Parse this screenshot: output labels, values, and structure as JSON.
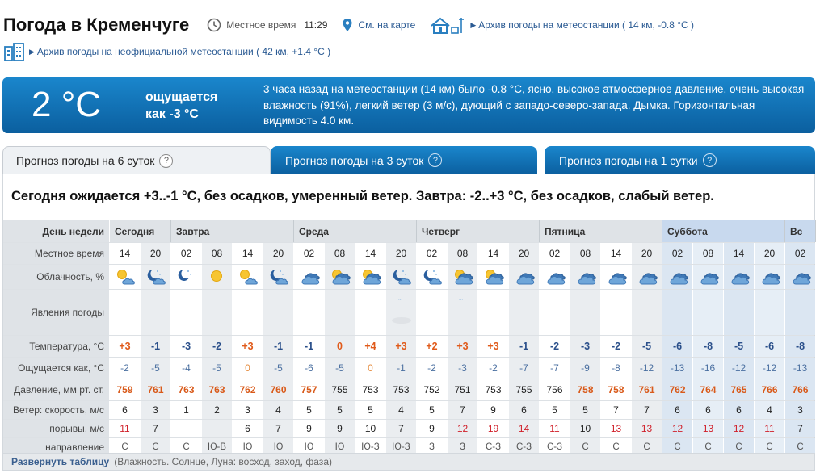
{
  "header": {
    "title": "Погода в Кременчуге",
    "local_time_label": "Местное время",
    "local_time": "11:29",
    "map_link": "См. на карте",
    "archive_station": "Архив погоды на метеостанции ( 14 км, -0.8 °C )",
    "archive_unofficial": "Архив погоды на неофициальной метеостанции ( 42 км, +1.4 °C )"
  },
  "current": {
    "temp": "2 °C",
    "feels_line1": "ощущается",
    "feels_line2": "как -3 °C",
    "description": "3 часа назад на метеостанции (14 км) было -0.8 °C, ясно, высокое атмосферное давление, очень высокая влажность (91%), легкий ветер (3 м/с), дующий с западо-северо-запада. Дымка. Горизонтальная видимость 4.0 км."
  },
  "tabs": [
    {
      "label": "Прогноз погоды на 6 суток"
    },
    {
      "label": "Прогноз погоды на 3 суток"
    },
    {
      "label": "Прогноз погоды на 1 сутки"
    }
  ],
  "summary": "Сегодня ожидается +3..-1 °C, без осадков, умеренный ветер. Завтра: -2..+3 °C, без осадков, слабый ветер.",
  "labels": {
    "day": "День недели",
    "time": "Местное время",
    "clouds": "Облачность, %",
    "phenomena": "Явления погоды",
    "temp": "Температура, °C",
    "feels": "Ощущается как, °C",
    "pressure": "Давление, мм рт. ст.",
    "wind_speed": "Ветер: скорость, м/с",
    "gusts": "порывы, м/с",
    "direction": "направление"
  },
  "days": [
    {
      "name": "Сегодня",
      "span": 2,
      "weekend": false
    },
    {
      "name": "Завтра",
      "span": 4,
      "weekend": false
    },
    {
      "name": "Среда",
      "span": 4,
      "weekend": false
    },
    {
      "name": "Четверг",
      "span": 4,
      "weekend": false
    },
    {
      "name": "Пятница",
      "span": 4,
      "weekend": false
    },
    {
      "name": "Суббота",
      "span": 4,
      "weekend": true
    },
    {
      "name": "Вс",
      "span": 1,
      "weekend": true
    }
  ],
  "times": [
    "14",
    "20",
    "02",
    "08",
    "14",
    "20",
    "02",
    "08",
    "14",
    "20",
    "02",
    "08",
    "14",
    "20",
    "02",
    "08",
    "14",
    "20",
    "02",
    "08",
    "14",
    "20",
    "02"
  ],
  "clouds": [
    "sun-cloud",
    "night-cloud",
    "night",
    "sun",
    "sun-cloud",
    "night-cloud",
    "clouds",
    "sun-clouds",
    "sun-clouds",
    "night-cloud",
    "night-cloud",
    "sun-clouds",
    "sun-clouds",
    "clouds",
    "clouds",
    "clouds",
    "clouds",
    "clouds",
    "clouds",
    "clouds",
    "clouds",
    "clouds",
    "clouds"
  ],
  "phenomena": [
    "",
    "",
    "",
    "",
    "",
    "",
    "",
    "",
    "",
    "fog",
    "",
    "snow",
    "",
    "",
    "",
    "",
    "",
    "",
    "",
    "",
    "",
    "",
    ""
  ],
  "temps": [
    "+3",
    "-1",
    "-3",
    "-2",
    "+3",
    "-1",
    "-1",
    "0",
    "+4",
    "+3",
    "+2",
    "+3",
    "+3",
    "-1",
    "-2",
    "-3",
    "-2",
    "-5",
    "-6",
    "-8",
    "-5",
    "-6",
    "-8"
  ],
  "feels": [
    "-2",
    "-5",
    "-4",
    "-5",
    "0",
    "-5",
    "-6",
    "-5",
    "0",
    "-1",
    "-2",
    "-3",
    "-2",
    "-7",
    "-7",
    "-9",
    "-8",
    "-12",
    "-13",
    "-16",
    "-12",
    "-12",
    "-13"
  ],
  "pressure": [
    "759",
    "761",
    "763",
    "763",
    "762",
    "760",
    "757",
    "755",
    "753",
    "753",
    "752",
    "751",
    "753",
    "755",
    "756",
    "758",
    "758",
    "761",
    "762",
    "764",
    "765",
    "766",
    "766"
  ],
  "pressure_hi": [
    true,
    true,
    true,
    true,
    true,
    true,
    true,
    false,
    false,
    false,
    false,
    false,
    false,
    false,
    false,
    true,
    true,
    true,
    true,
    true,
    true,
    true,
    true
  ],
  "wind": [
    "6",
    "3",
    "1",
    "2",
    "3",
    "4",
    "5",
    "5",
    "5",
    "4",
    "5",
    "7",
    "9",
    "6",
    "5",
    "5",
    "7",
    "7",
    "6",
    "6",
    "6",
    "4",
    "3"
  ],
  "gusts": [
    "11",
    "7",
    "",
    "",
    "6",
    "7",
    "9",
    "9",
    "10",
    "7",
    "9",
    "12",
    "19",
    "14",
    "11",
    "10",
    "13",
    "13",
    "12",
    "13",
    "12",
    "11",
    "7"
  ],
  "directions": [
    "С",
    "С",
    "С",
    "Ю-В",
    "Ю",
    "Ю",
    "Ю",
    "Ю",
    "Ю-З",
    "Ю-З",
    "З",
    "З",
    "С-З",
    "С-З",
    "С-З",
    "С",
    "С",
    "С",
    "С",
    "С",
    "С",
    "С",
    "С"
  ],
  "expand": {
    "label": "Развернуть таблицу",
    "note": "(Влажность. Солнце, Луна: восход, заход, фаза)"
  },
  "colors": {
    "accent": "#0b5f9f",
    "positive_temp": "#e05a1a",
    "negative_temp": "#2a4f8a",
    "gust_high": "#d0202a"
  }
}
